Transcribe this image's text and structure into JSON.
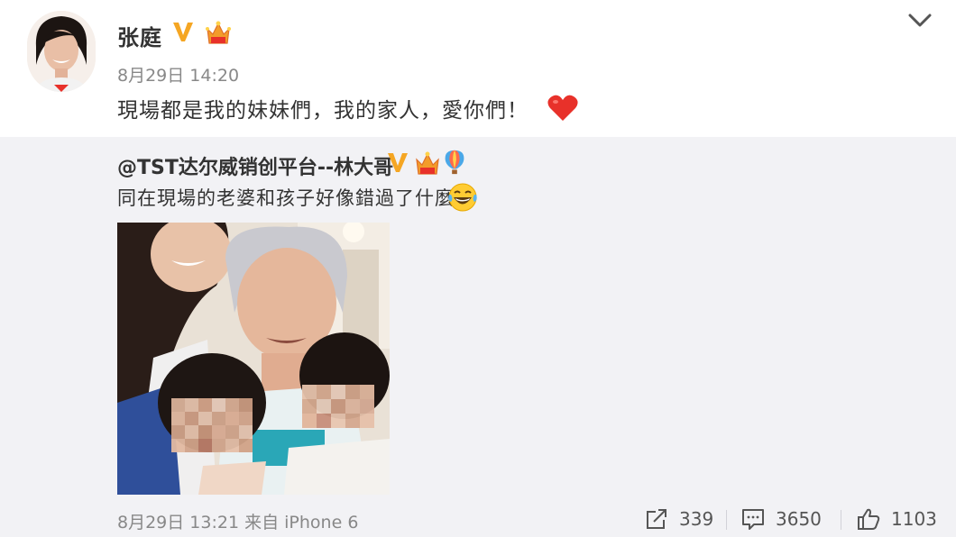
{
  "post": {
    "user_name": "张庭",
    "timestamp": "8月29日 14:20",
    "text": "現場都是我的妹妹們，我的家人，愛你們！",
    "emoji": "heart-icon"
  },
  "repost": {
    "author": "@TST达尔威销创平台--林大哥",
    "text": "同在現場的老婆和孩子好像錯過了什麼",
    "emoji": "laughing-tears-icon",
    "timestamp": "8月29日 13:21 来自 iPhone 6",
    "actions": {
      "share_count": "339",
      "comment_count": "3650",
      "like_count": "1103"
    }
  },
  "colors": {
    "verified_gold": "#f5a623",
    "repost_bg": "#f2f2f5",
    "muted_text": "#888888",
    "heart_red": "#e8312a"
  }
}
